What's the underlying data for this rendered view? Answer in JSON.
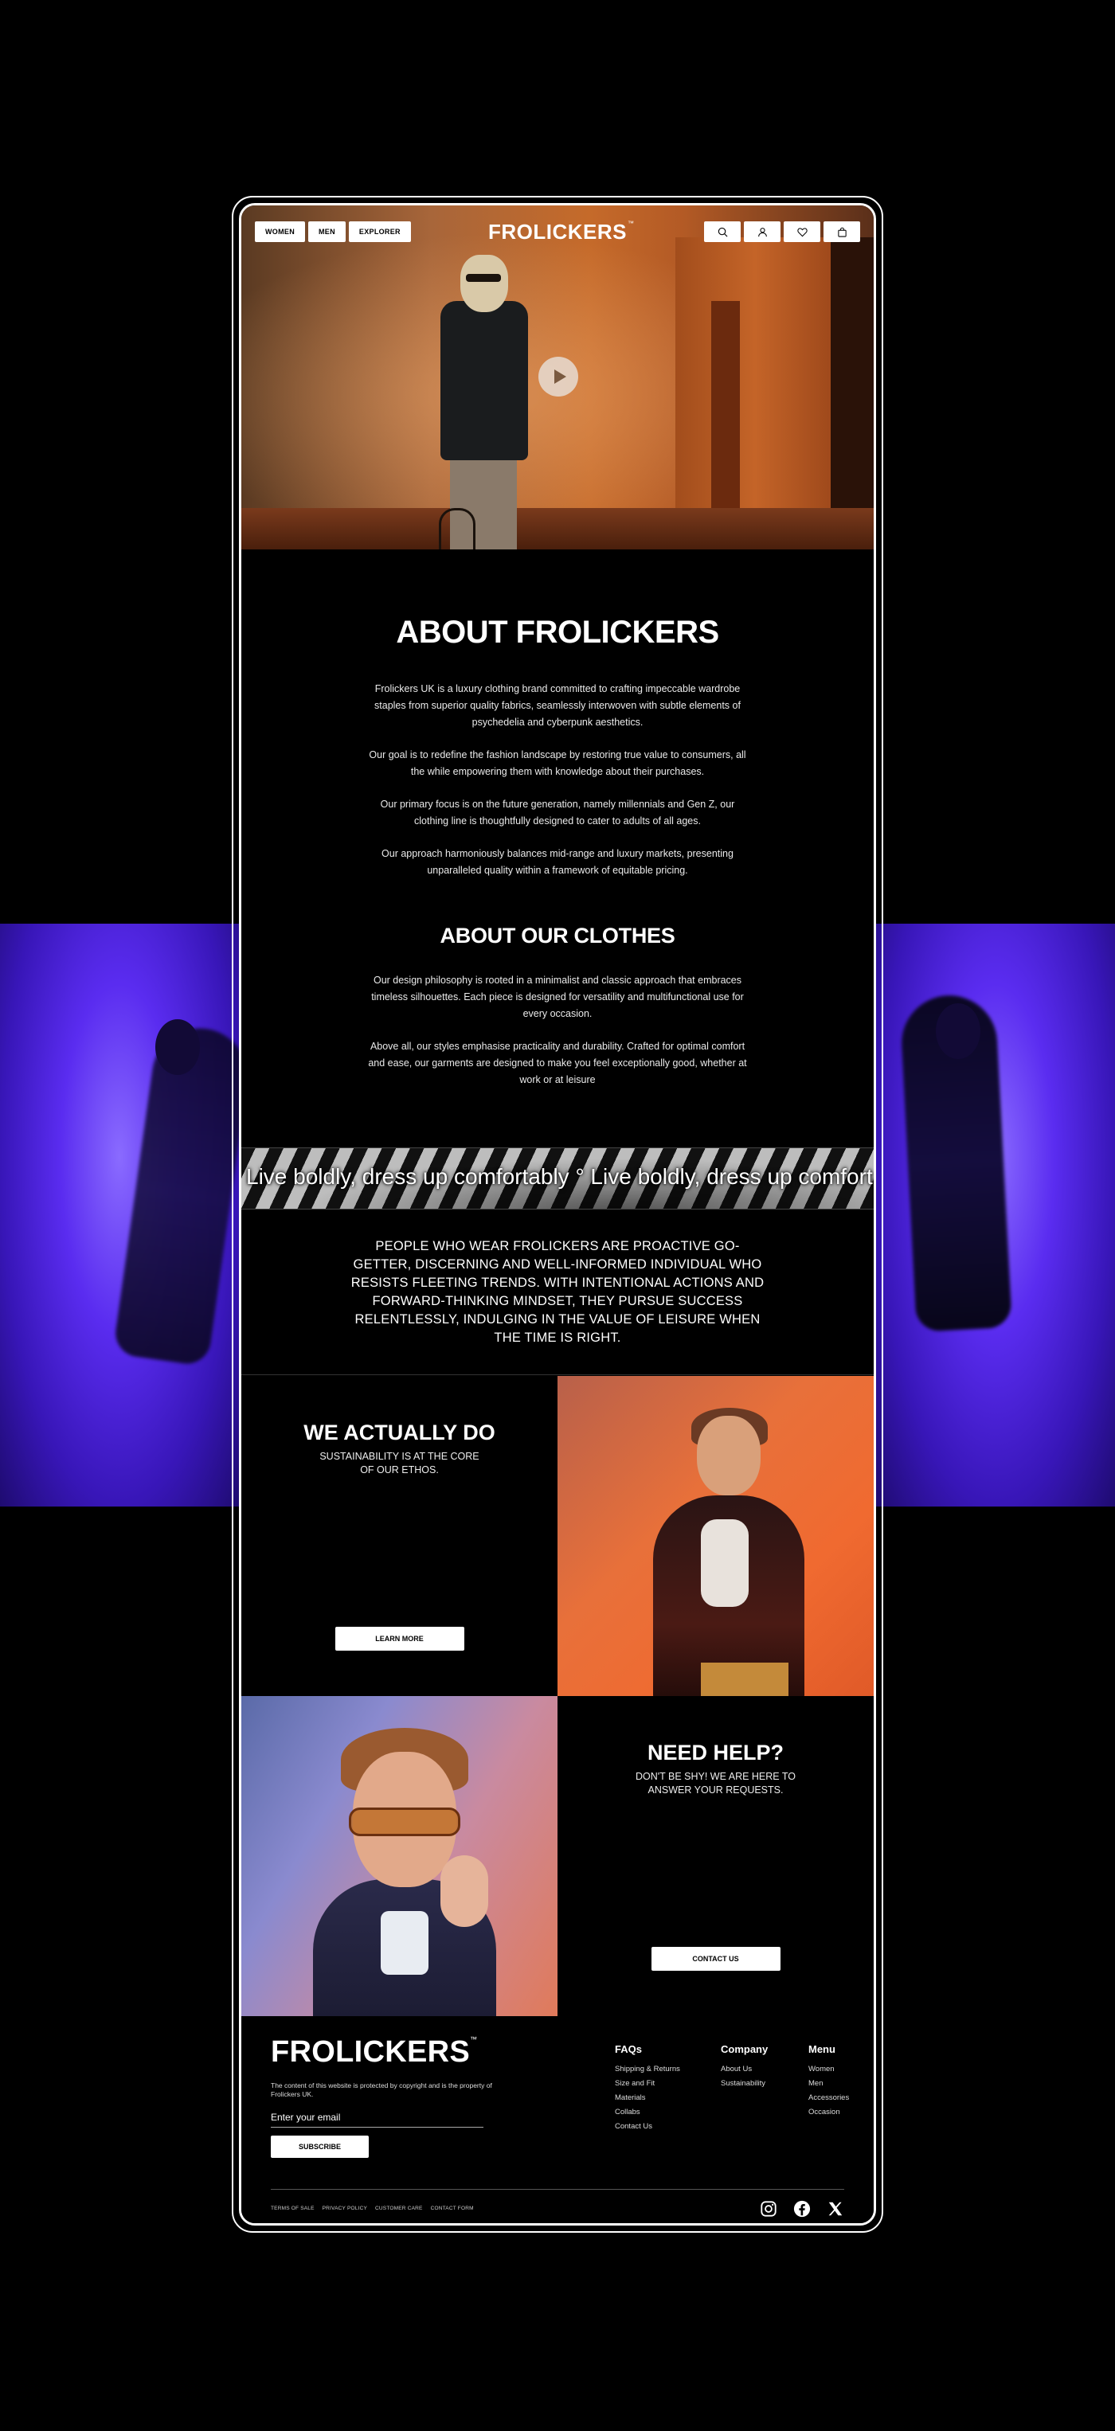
{
  "nav": {
    "left": [
      "WOMEN",
      "MEN",
      "EXPLORER"
    ],
    "logo": "FROLICKERS",
    "logo_tm": "™",
    "icons": [
      "search-icon",
      "user-icon",
      "heart-icon",
      "bag-icon"
    ]
  },
  "about": {
    "title": "ABOUT FROLICKERS",
    "paragraphs": [
      "Frolickers UK is a luxury clothing brand committed to crafting impeccable wardrobe staples from superior quality fabrics, seamlessly interwoven with subtle elements of psychedelia and cyberpunk aesthetics.",
      "Our goal is to redefine the fashion landscape by restoring true value to consumers, all the while empowering them with knowledge about their purchases.",
      "Our primary focus is on the future generation, namely millennials and Gen Z, our clothing line is thoughtfully designed to cater to adults of all ages.",
      "Our approach harmoniously balances mid-range and luxury markets, presenting unparalleled quality within a framework of equitable pricing."
    ],
    "clothes_title": "ABOUT OUR CLOTHES",
    "clothes_paragraphs": [
      "Our design philosophy is rooted in a minimalist and classic approach that embraces timeless silhouettes. Each piece is designed for versatility and multifunctional use for every occasion.",
      "Above all, our styles emphasise practicality and durability. Crafted for optimal comfort and ease, our garments are designed to make you feel exceptionally good, whether at work or at leisure"
    ]
  },
  "marquee": {
    "text": "Live boldly, dress up comfortably ° Live boldly, dress up comfortably"
  },
  "manifesto": {
    "text": "PEOPLE WHO WEAR FROLICKERS ARE PROACTIVE GO-GETTER, DISCERNING AND WELL-INFORMED INDIVIDUAL WHO RESISTS FLEETING TRENDS. WITH INTENTIONAL ACTIONS AND FORWARD-THINKING MINDSET, THEY PURSUE SUCCESS RELENTLESSLY, INDULGING IN THE VALUE OF LEISURE WHEN THE TIME IS RIGHT."
  },
  "sustain": {
    "title": "WE ACTUALLY DO",
    "subtitle": "SUSTAINABILITY IS AT THE CORE OF OUR ETHOS.",
    "button": "LEARN MORE"
  },
  "help": {
    "title": "NEED HELP?",
    "subtitle": "DON'T BE SHY! WE ARE HERE TO ANSWER YOUR REQUESTS.",
    "button": "CONTACT US"
  },
  "footer": {
    "logo": "FROLICKERS",
    "logo_tm": "™",
    "copyright": "The content of this website is protected by copyright and is the property of Frolickers UK.",
    "email_placeholder": "Enter your email",
    "subscribe": "SUBSCRIBE",
    "columns": [
      {
        "title": "FAQs",
        "links": [
          "Shipping & Returns",
          "Size and Fit",
          "Materials",
          "Collabs",
          "Contact Us"
        ]
      },
      {
        "title": "Company",
        "links": [
          "About Us",
          "Sustainability"
        ]
      },
      {
        "title": "Menu",
        "links": [
          "Women",
          "Men",
          "Accessories",
          "Occasion"
        ]
      }
    ],
    "legal": [
      "TERMS OF SALE",
      "PRIVACY POLICY",
      "CUSTOMER CARE",
      "CONTACT FORM"
    ],
    "social": [
      "instagram-icon",
      "facebook-icon",
      "x-icon"
    ]
  }
}
